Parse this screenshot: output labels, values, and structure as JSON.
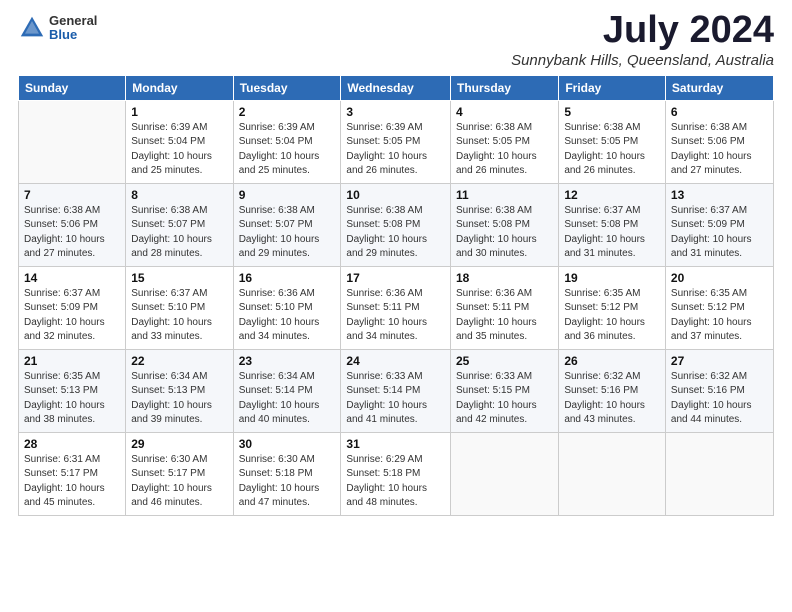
{
  "header": {
    "logo": {
      "line1": "General",
      "line2": "Blue"
    },
    "title": "July 2024",
    "subtitle": "Sunnybank Hills, Queensland, Australia"
  },
  "days_of_week": [
    "Sunday",
    "Monday",
    "Tuesday",
    "Wednesday",
    "Thursday",
    "Friday",
    "Saturday"
  ],
  "weeks": [
    [
      {
        "num": "",
        "sunrise": "",
        "sunset": "",
        "daylight": ""
      },
      {
        "num": "1",
        "sunrise": "Sunrise: 6:39 AM",
        "sunset": "Sunset: 5:04 PM",
        "daylight": "Daylight: 10 hours and 25 minutes."
      },
      {
        "num": "2",
        "sunrise": "Sunrise: 6:39 AM",
        "sunset": "Sunset: 5:04 PM",
        "daylight": "Daylight: 10 hours and 25 minutes."
      },
      {
        "num": "3",
        "sunrise": "Sunrise: 6:39 AM",
        "sunset": "Sunset: 5:05 PM",
        "daylight": "Daylight: 10 hours and 26 minutes."
      },
      {
        "num": "4",
        "sunrise": "Sunrise: 6:38 AM",
        "sunset": "Sunset: 5:05 PM",
        "daylight": "Daylight: 10 hours and 26 minutes."
      },
      {
        "num": "5",
        "sunrise": "Sunrise: 6:38 AM",
        "sunset": "Sunset: 5:05 PM",
        "daylight": "Daylight: 10 hours and 26 minutes."
      },
      {
        "num": "6",
        "sunrise": "Sunrise: 6:38 AM",
        "sunset": "Sunset: 5:06 PM",
        "daylight": "Daylight: 10 hours and 27 minutes."
      }
    ],
    [
      {
        "num": "7",
        "sunrise": "Sunrise: 6:38 AM",
        "sunset": "Sunset: 5:06 PM",
        "daylight": "Daylight: 10 hours and 27 minutes."
      },
      {
        "num": "8",
        "sunrise": "Sunrise: 6:38 AM",
        "sunset": "Sunset: 5:07 PM",
        "daylight": "Daylight: 10 hours and 28 minutes."
      },
      {
        "num": "9",
        "sunrise": "Sunrise: 6:38 AM",
        "sunset": "Sunset: 5:07 PM",
        "daylight": "Daylight: 10 hours and 29 minutes."
      },
      {
        "num": "10",
        "sunrise": "Sunrise: 6:38 AM",
        "sunset": "Sunset: 5:08 PM",
        "daylight": "Daylight: 10 hours and 29 minutes."
      },
      {
        "num": "11",
        "sunrise": "Sunrise: 6:38 AM",
        "sunset": "Sunset: 5:08 PM",
        "daylight": "Daylight: 10 hours and 30 minutes."
      },
      {
        "num": "12",
        "sunrise": "Sunrise: 6:37 AM",
        "sunset": "Sunset: 5:08 PM",
        "daylight": "Daylight: 10 hours and 31 minutes."
      },
      {
        "num": "13",
        "sunrise": "Sunrise: 6:37 AM",
        "sunset": "Sunset: 5:09 PM",
        "daylight": "Daylight: 10 hours and 31 minutes."
      }
    ],
    [
      {
        "num": "14",
        "sunrise": "Sunrise: 6:37 AM",
        "sunset": "Sunset: 5:09 PM",
        "daylight": "Daylight: 10 hours and 32 minutes."
      },
      {
        "num": "15",
        "sunrise": "Sunrise: 6:37 AM",
        "sunset": "Sunset: 5:10 PM",
        "daylight": "Daylight: 10 hours and 33 minutes."
      },
      {
        "num": "16",
        "sunrise": "Sunrise: 6:36 AM",
        "sunset": "Sunset: 5:10 PM",
        "daylight": "Daylight: 10 hours and 34 minutes."
      },
      {
        "num": "17",
        "sunrise": "Sunrise: 6:36 AM",
        "sunset": "Sunset: 5:11 PM",
        "daylight": "Daylight: 10 hours and 34 minutes."
      },
      {
        "num": "18",
        "sunrise": "Sunrise: 6:36 AM",
        "sunset": "Sunset: 5:11 PM",
        "daylight": "Daylight: 10 hours and 35 minutes."
      },
      {
        "num": "19",
        "sunrise": "Sunrise: 6:35 AM",
        "sunset": "Sunset: 5:12 PM",
        "daylight": "Daylight: 10 hours and 36 minutes."
      },
      {
        "num": "20",
        "sunrise": "Sunrise: 6:35 AM",
        "sunset": "Sunset: 5:12 PM",
        "daylight": "Daylight: 10 hours and 37 minutes."
      }
    ],
    [
      {
        "num": "21",
        "sunrise": "Sunrise: 6:35 AM",
        "sunset": "Sunset: 5:13 PM",
        "daylight": "Daylight: 10 hours and 38 minutes."
      },
      {
        "num": "22",
        "sunrise": "Sunrise: 6:34 AM",
        "sunset": "Sunset: 5:13 PM",
        "daylight": "Daylight: 10 hours and 39 minutes."
      },
      {
        "num": "23",
        "sunrise": "Sunrise: 6:34 AM",
        "sunset": "Sunset: 5:14 PM",
        "daylight": "Daylight: 10 hours and 40 minutes."
      },
      {
        "num": "24",
        "sunrise": "Sunrise: 6:33 AM",
        "sunset": "Sunset: 5:14 PM",
        "daylight": "Daylight: 10 hours and 41 minutes."
      },
      {
        "num": "25",
        "sunrise": "Sunrise: 6:33 AM",
        "sunset": "Sunset: 5:15 PM",
        "daylight": "Daylight: 10 hours and 42 minutes."
      },
      {
        "num": "26",
        "sunrise": "Sunrise: 6:32 AM",
        "sunset": "Sunset: 5:16 PM",
        "daylight": "Daylight: 10 hours and 43 minutes."
      },
      {
        "num": "27",
        "sunrise": "Sunrise: 6:32 AM",
        "sunset": "Sunset: 5:16 PM",
        "daylight": "Daylight: 10 hours and 44 minutes."
      }
    ],
    [
      {
        "num": "28",
        "sunrise": "Sunrise: 6:31 AM",
        "sunset": "Sunset: 5:17 PM",
        "daylight": "Daylight: 10 hours and 45 minutes."
      },
      {
        "num": "29",
        "sunrise": "Sunrise: 6:30 AM",
        "sunset": "Sunset: 5:17 PM",
        "daylight": "Daylight: 10 hours and 46 minutes."
      },
      {
        "num": "30",
        "sunrise": "Sunrise: 6:30 AM",
        "sunset": "Sunset: 5:18 PM",
        "daylight": "Daylight: 10 hours and 47 minutes."
      },
      {
        "num": "31",
        "sunrise": "Sunrise: 6:29 AM",
        "sunset": "Sunset: 5:18 PM",
        "daylight": "Daylight: 10 hours and 48 minutes."
      },
      {
        "num": "",
        "sunrise": "",
        "sunset": "",
        "daylight": ""
      },
      {
        "num": "",
        "sunrise": "",
        "sunset": "",
        "daylight": ""
      },
      {
        "num": "",
        "sunrise": "",
        "sunset": "",
        "daylight": ""
      }
    ]
  ]
}
